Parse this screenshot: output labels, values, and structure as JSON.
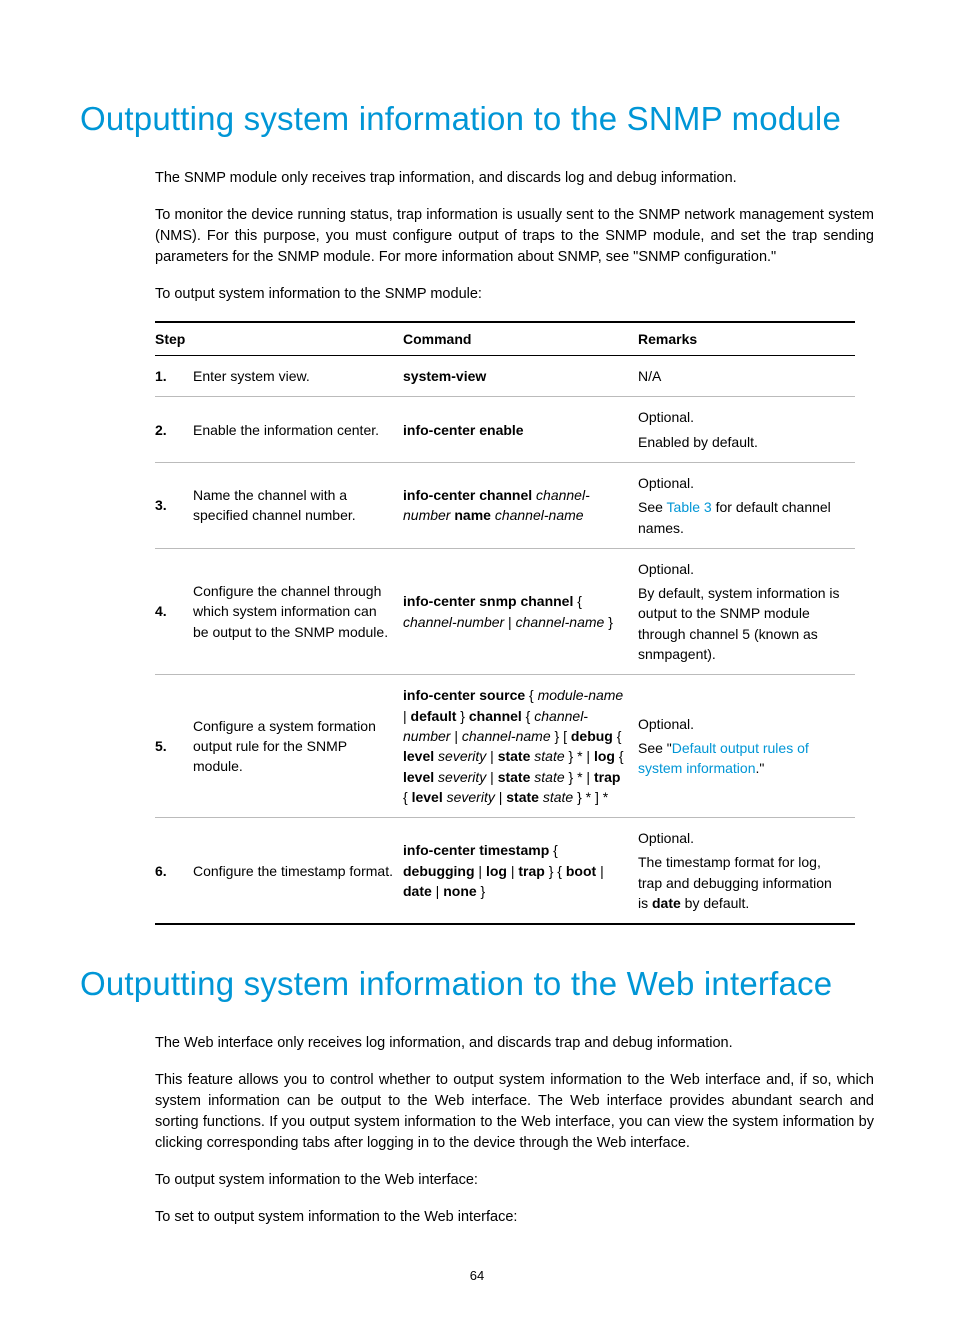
{
  "snmp": {
    "title": "Outputting system information to the SNMP module",
    "p1": "The SNMP module only receives trap information, and discards log and debug information.",
    "p2": "To monitor the device running status, trap information is usually sent to the SNMP network management system (NMS). For this purpose, you must configure output of traps to the SNMP module, and set the trap sending parameters for the SNMP module. For more information about SNMP, see \"SNMP configuration.\"",
    "p3": "To output system information to the SNMP module:",
    "headers": {
      "step": "Step",
      "cmd": "Command",
      "rem": "Remarks"
    },
    "rows": [
      {
        "n": "1.",
        "step": "Enter system view.",
        "cmd": [
          {
            "t": "system-view",
            "b": true
          }
        ],
        "rem": [
          [
            {
              "t": "N/A"
            }
          ]
        ]
      },
      {
        "n": "2.",
        "step": "Enable the information center.",
        "cmd": [
          {
            "t": "info-center enable",
            "b": true
          }
        ],
        "rem": [
          [
            {
              "t": "Optional."
            }
          ],
          [
            {
              "t": "Enabled by default."
            }
          ]
        ]
      },
      {
        "n": "3.",
        "step": "Name the channel with a specified channel number.",
        "cmd": [
          {
            "t": "info-center channel",
            "b": true
          },
          {
            "t": " "
          },
          {
            "t": "channel-number",
            "i": true
          },
          {
            "t": " "
          },
          {
            "t": "name",
            "b": true
          },
          {
            "t": " "
          },
          {
            "t": "channel-name",
            "i": true
          }
        ],
        "rem": [
          [
            {
              "t": "Optional."
            }
          ],
          [
            {
              "t": "See "
            },
            {
              "t": "Table 3",
              "link": true
            },
            {
              "t": " for default channel names."
            }
          ]
        ]
      },
      {
        "n": "4.",
        "step": "Configure the channel through which system information can be output to the SNMP module.",
        "cmd": [
          {
            "t": "info-center snmp channel",
            "b": true
          },
          {
            "t": " { "
          },
          {
            "t": "channel-number",
            "i": true
          },
          {
            "t": " | "
          },
          {
            "t": "channel-name",
            "i": true
          },
          {
            "t": " }"
          }
        ],
        "rem": [
          [
            {
              "t": "Optional."
            }
          ],
          [
            {
              "t": "By default, system information is output to the SNMP module through channel 5 (known as snmpagent)."
            }
          ]
        ]
      },
      {
        "n": "5.",
        "step": "Configure a system formation output rule for the SNMP module.",
        "cmd": [
          {
            "t": "info-center source",
            "b": true
          },
          {
            "t": " { "
          },
          {
            "t": "module-name",
            "i": true
          },
          {
            "t": " | "
          },
          {
            "t": "default",
            "b": true
          },
          {
            "t": " } "
          },
          {
            "t": "channel",
            "b": true
          },
          {
            "t": " { "
          },
          {
            "t": "channel-number",
            "i": true
          },
          {
            "t": " | "
          },
          {
            "t": "channel-name",
            "i": true
          },
          {
            "t": " } [ "
          },
          {
            "t": "debug",
            "b": true
          },
          {
            "t": " { "
          },
          {
            "t": "level",
            "b": true
          },
          {
            "t": " "
          },
          {
            "t": "severity",
            "i": true
          },
          {
            "t": " | "
          },
          {
            "t": "state",
            "b": true
          },
          {
            "t": " "
          },
          {
            "t": "state",
            "i": true
          },
          {
            "t": " } * | "
          },
          {
            "t": "log",
            "b": true
          },
          {
            "t": " { "
          },
          {
            "t": "level",
            "b": true
          },
          {
            "t": " "
          },
          {
            "t": "severity",
            "i": true
          },
          {
            "t": " | "
          },
          {
            "t": "state",
            "b": true
          },
          {
            "t": " "
          },
          {
            "t": "state",
            "i": true
          },
          {
            "t": " } * | "
          },
          {
            "t": "trap",
            "b": true
          },
          {
            "t": " { "
          },
          {
            "t": "level",
            "b": true
          },
          {
            "t": " "
          },
          {
            "t": "severity",
            "i": true
          },
          {
            "t": " | "
          },
          {
            "t": "state",
            "b": true
          },
          {
            "t": " "
          },
          {
            "t": "state",
            "i": true
          },
          {
            "t": " } * ] *"
          }
        ],
        "rem": [
          [
            {
              "t": "Optional."
            }
          ],
          [
            {
              "t": "See \""
            },
            {
              "t": "Default output rules of system information",
              "link": true
            },
            {
              "t": ".\""
            }
          ]
        ]
      },
      {
        "n": "6.",
        "step": "Configure the timestamp format.",
        "cmd": [
          {
            "t": "info-center timestamp",
            "b": true
          },
          {
            "t": " { "
          },
          {
            "t": "debugging",
            "b": true
          },
          {
            "t": " | "
          },
          {
            "t": "log",
            "b": true
          },
          {
            "t": " | "
          },
          {
            "t": "trap",
            "b": true
          },
          {
            "t": " } { "
          },
          {
            "t": "boot",
            "b": true
          },
          {
            "t": " | "
          },
          {
            "t": "date",
            "b": true
          },
          {
            "t": " | "
          },
          {
            "t": "none",
            "b": true
          },
          {
            "t": " }"
          }
        ],
        "rem": [
          [
            {
              "t": "Optional."
            }
          ],
          [
            {
              "t": "The timestamp format for log, trap and debugging information is "
            },
            {
              "t": "date",
              "b": true
            },
            {
              "t": " by default."
            }
          ]
        ]
      }
    ]
  },
  "web": {
    "title": "Outputting system information to the Web interface",
    "p1": "The Web interface only receives log information, and discards trap and debug information.",
    "p2": "This feature allows you to control whether to output system information to the Web interface and, if so, which system information can be output to the Web interface. The Web interface provides abundant search and sorting functions. If you output system information to the Web interface, you can view the system information by clicking corresponding tabs after logging in to the device through the Web interface.",
    "p3": "To output system information to the Web interface:",
    "p4": "To set to output system information to the Web interface:"
  },
  "pagenum": "64"
}
